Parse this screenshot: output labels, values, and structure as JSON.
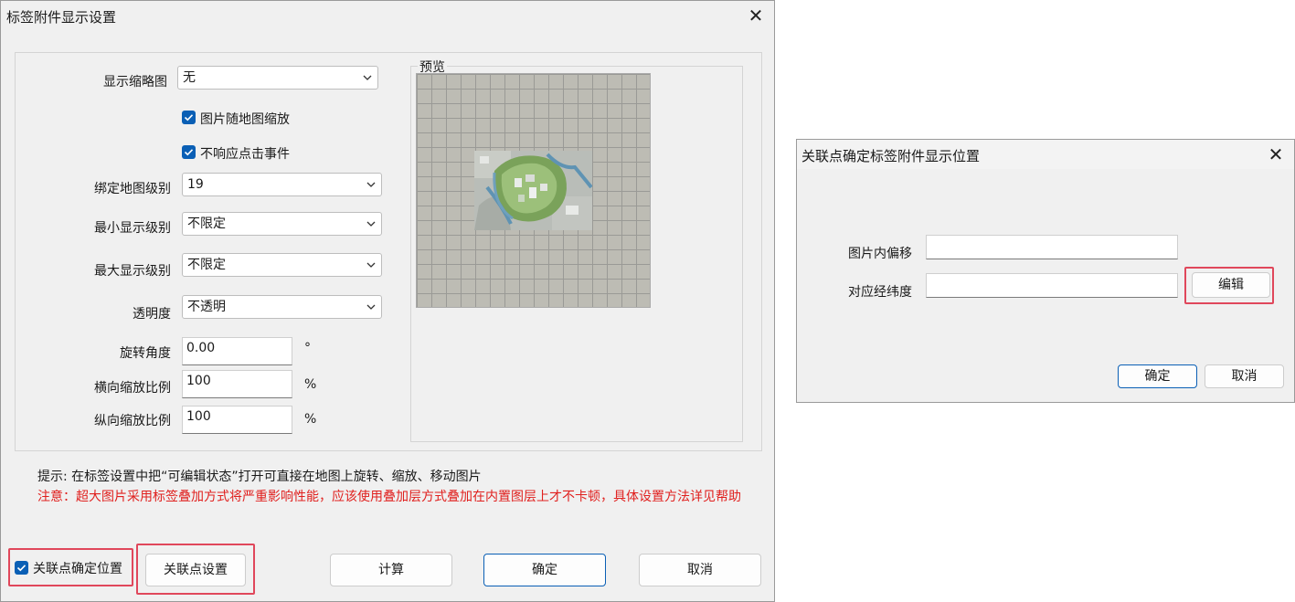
{
  "dialog1": {
    "title": "标签附件显示设置",
    "thumbnail_label": "显示缩略图",
    "thumbnail_value": "无",
    "scale_with_map_label": "图片随地图缩放",
    "ignore_click_label": "不响应点击事件",
    "bind_level_label": "绑定地图级别",
    "bind_level_value": "19",
    "min_level_label": "最小显示级别",
    "min_level_value": "不限定",
    "max_level_label": "最大显示级别",
    "max_level_value": "不限定",
    "opacity_label": "透明度",
    "opacity_value": "不透明",
    "rotation_label": "旋转角度",
    "rotation_value": "0.00",
    "rotation_unit": "°",
    "hscale_label": "横向缩放比例",
    "hscale_value": "100",
    "hscale_unit": "%",
    "vscale_label": "纵向缩放比例",
    "vscale_value": "100",
    "vscale_unit": "%",
    "preview_label": "预览",
    "hint": "提示: 在标签设置中把“可编辑状态”打开可直接在地图上旋转、缩放、移动图片",
    "warning": "注意：超大图片采用标签叠加方式将严重影响性能，应该使用叠加层方式叠加在内置图层上才不卡顿，具体设置方法详见帮助",
    "anchor_checkbox_label": "关联点确定位置",
    "anchor_settings_button": "关联点设置",
    "calc_button": "计算",
    "ok_button": "确定",
    "cancel_button": "取消"
  },
  "dialog2": {
    "title": "关联点确定标签附件显示位置",
    "offset_label": "图片内偏移",
    "offset_value": "",
    "lnglat_label": "对应经纬度",
    "lnglat_value": "",
    "edit_button": "编辑",
    "ok_button": "确定",
    "cancel_button": "取消"
  },
  "colors": {
    "accent": "#0a5fb5",
    "highlight": "#e0475b",
    "warning_text": "#e0201e"
  }
}
